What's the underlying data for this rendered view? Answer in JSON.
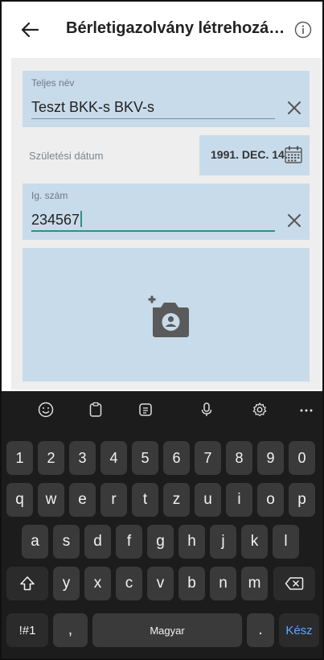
{
  "header": {
    "title": "Bérletigazolvány létrehozá…",
    "back_icon": "back-arrow-icon",
    "info_icon": "info-icon"
  },
  "form": {
    "name_field": {
      "label": "Teljes név",
      "value": "Teszt BKK-s BKV-s"
    },
    "dob": {
      "label": "Születési dátum",
      "value": "1991. DEC. 14."
    },
    "id_field": {
      "label": "Ig. szám",
      "value": "234567"
    },
    "photo": {
      "icon": "add-photo-icon"
    }
  },
  "keyboard": {
    "toolbar": [
      "emoji-icon",
      "clipboard-icon",
      "text-editor-icon",
      "mic-icon",
      "settings-icon",
      "more-icon"
    ],
    "numbers": [
      "1",
      "2",
      "3",
      "4",
      "5",
      "6",
      "7",
      "8",
      "9",
      "0"
    ],
    "row1": [
      "q",
      "w",
      "e",
      "r",
      "t",
      "z",
      "u",
      "i",
      "o",
      "p"
    ],
    "row2": [
      "a",
      "s",
      "d",
      "f",
      "g",
      "h",
      "j",
      "k",
      "l"
    ],
    "row3": [
      "y",
      "x",
      "c",
      "v",
      "b",
      "n",
      "m"
    ],
    "symbols_key": "!#1",
    "comma_key": ",",
    "space_key": "Magyar",
    "period_key": ".",
    "done_key": "Kész"
  },
  "colors": {
    "field_bg": "#c8dbea",
    "accent": "#2f8f86",
    "keyboard_bg": "#1c1c1c",
    "key_bg": "#3a3a3a",
    "done_color": "#5aa8ff"
  }
}
